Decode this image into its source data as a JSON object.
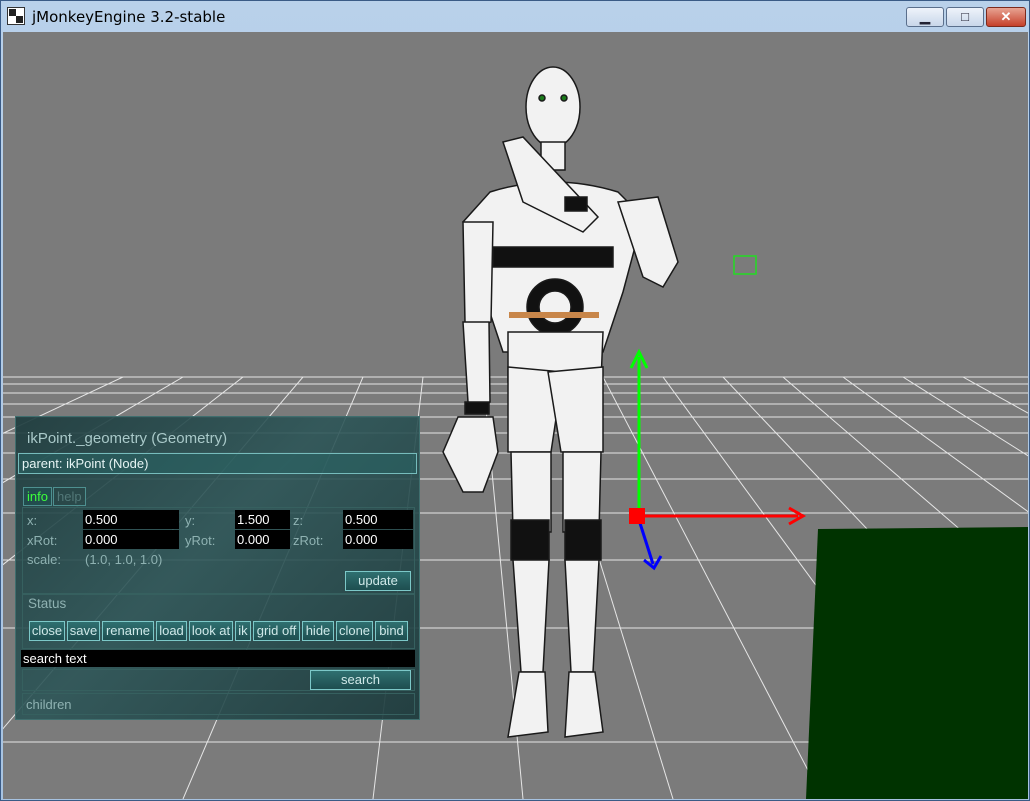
{
  "window": {
    "title": "jMonkeyEngine 3.2-stable",
    "controls": {
      "minimize": "▁",
      "maximize": "□",
      "close": "✕"
    }
  },
  "colors": {
    "viewport_bg": "#7b7b7b",
    "grid": "#e6e6e6",
    "x_axis": "#ff0000",
    "y_axis": "#00ff00",
    "z_axis": "#0000ff",
    "floor_block": "#003300",
    "panel_bg": "#24494a",
    "active_tab": "#3cff3c"
  },
  "scene": {
    "model": "robot-figure",
    "gizmo": "transform-axes-icon",
    "marker": "ik-target-marker-icon"
  },
  "panel": {
    "title": "ikPoint._geometry (Geometry)",
    "parent": "parent: ikPoint (Node)",
    "tabs": [
      {
        "label": "info",
        "active": true
      },
      {
        "label": "help",
        "active": false
      }
    ],
    "transform": {
      "x_label": "x:",
      "x_value": "0.500",
      "y_label": "y:",
      "y_value": "1.500",
      "z_label": "z:",
      "z_value": "0.500",
      "xrot_label": "xRot:",
      "xrot_value": "0.000",
      "yrot_label": "yRot:",
      "yrot_value": "0.000",
      "zrot_label": "zRot:",
      "zrot_value": "0.000",
      "scale_label": "scale:",
      "scale_value": "(1.0, 1.0, 1.0)"
    },
    "update_button": "update",
    "status_label": "Status",
    "actions": [
      "close",
      "save",
      "rename",
      "load",
      "look at",
      "ik",
      "grid off",
      "hide",
      "clone",
      "bind"
    ],
    "search_text": "search text",
    "search_button": "search",
    "children_label": "children"
  }
}
